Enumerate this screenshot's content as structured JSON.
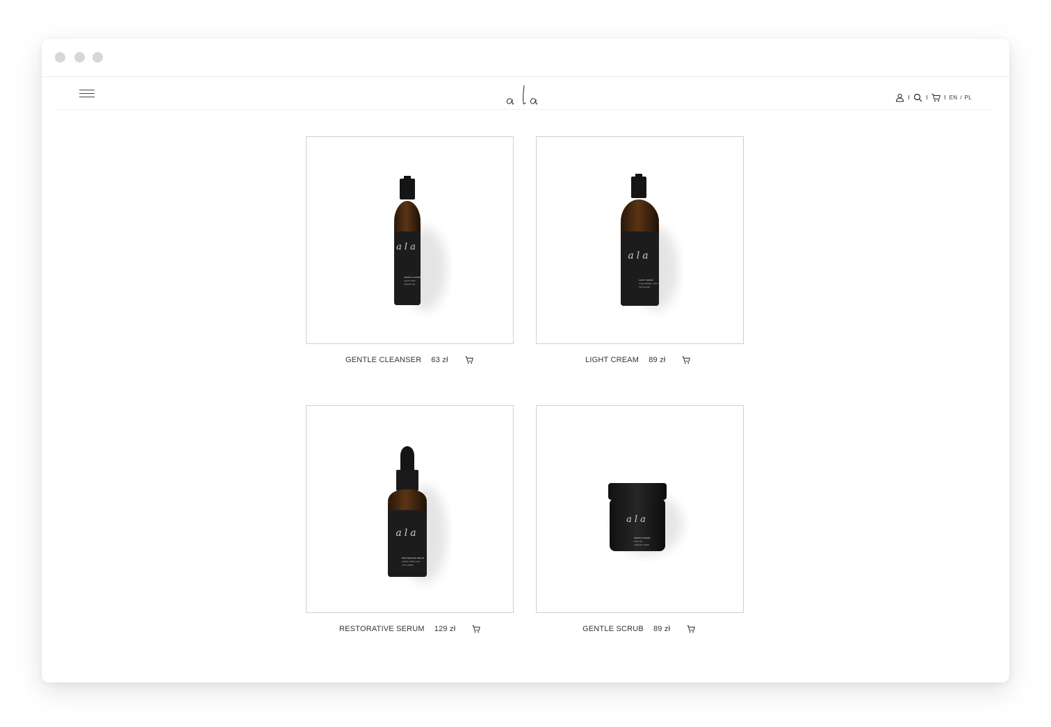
{
  "brand": {
    "logo_text": "ala"
  },
  "header": {
    "lang_en": "EN",
    "lang_sep": "/",
    "lang_pl": "PL"
  },
  "products": [
    {
      "name": "GENTLE CLEANSER",
      "price": "63 zł",
      "label_lines": [
        "GENTLE CLEANSER",
        "ALOE VERA",
        "ARGAN OIL"
      ]
    },
    {
      "name": "LIGHT CREAM",
      "price": "89 zł",
      "label_lines": [
        "LIGHT CREAM",
        "HYALURONIC ACID",
        "SQUALANE"
      ]
    },
    {
      "name": "RESTORATIVE SERUM",
      "price": "129 zł",
      "label_lines": [
        "RESTORATIVE SERUM",
        "APPLE STEM CELL",
        "COLLAGEN"
      ]
    },
    {
      "name": "GENTLE SCRUB",
      "price": "89 zł",
      "label_lines": [
        "GENTLE SCRUB",
        "RICE OIL",
        "APRICOT SEED"
      ]
    }
  ],
  "colors": {
    "bottle_glass": "#3a2410",
    "bottle_label": "#1c1c1c",
    "border": "#cfcfcf"
  },
  "icons": [
    "menu-icon",
    "user-icon",
    "search-icon",
    "cart-icon"
  ]
}
